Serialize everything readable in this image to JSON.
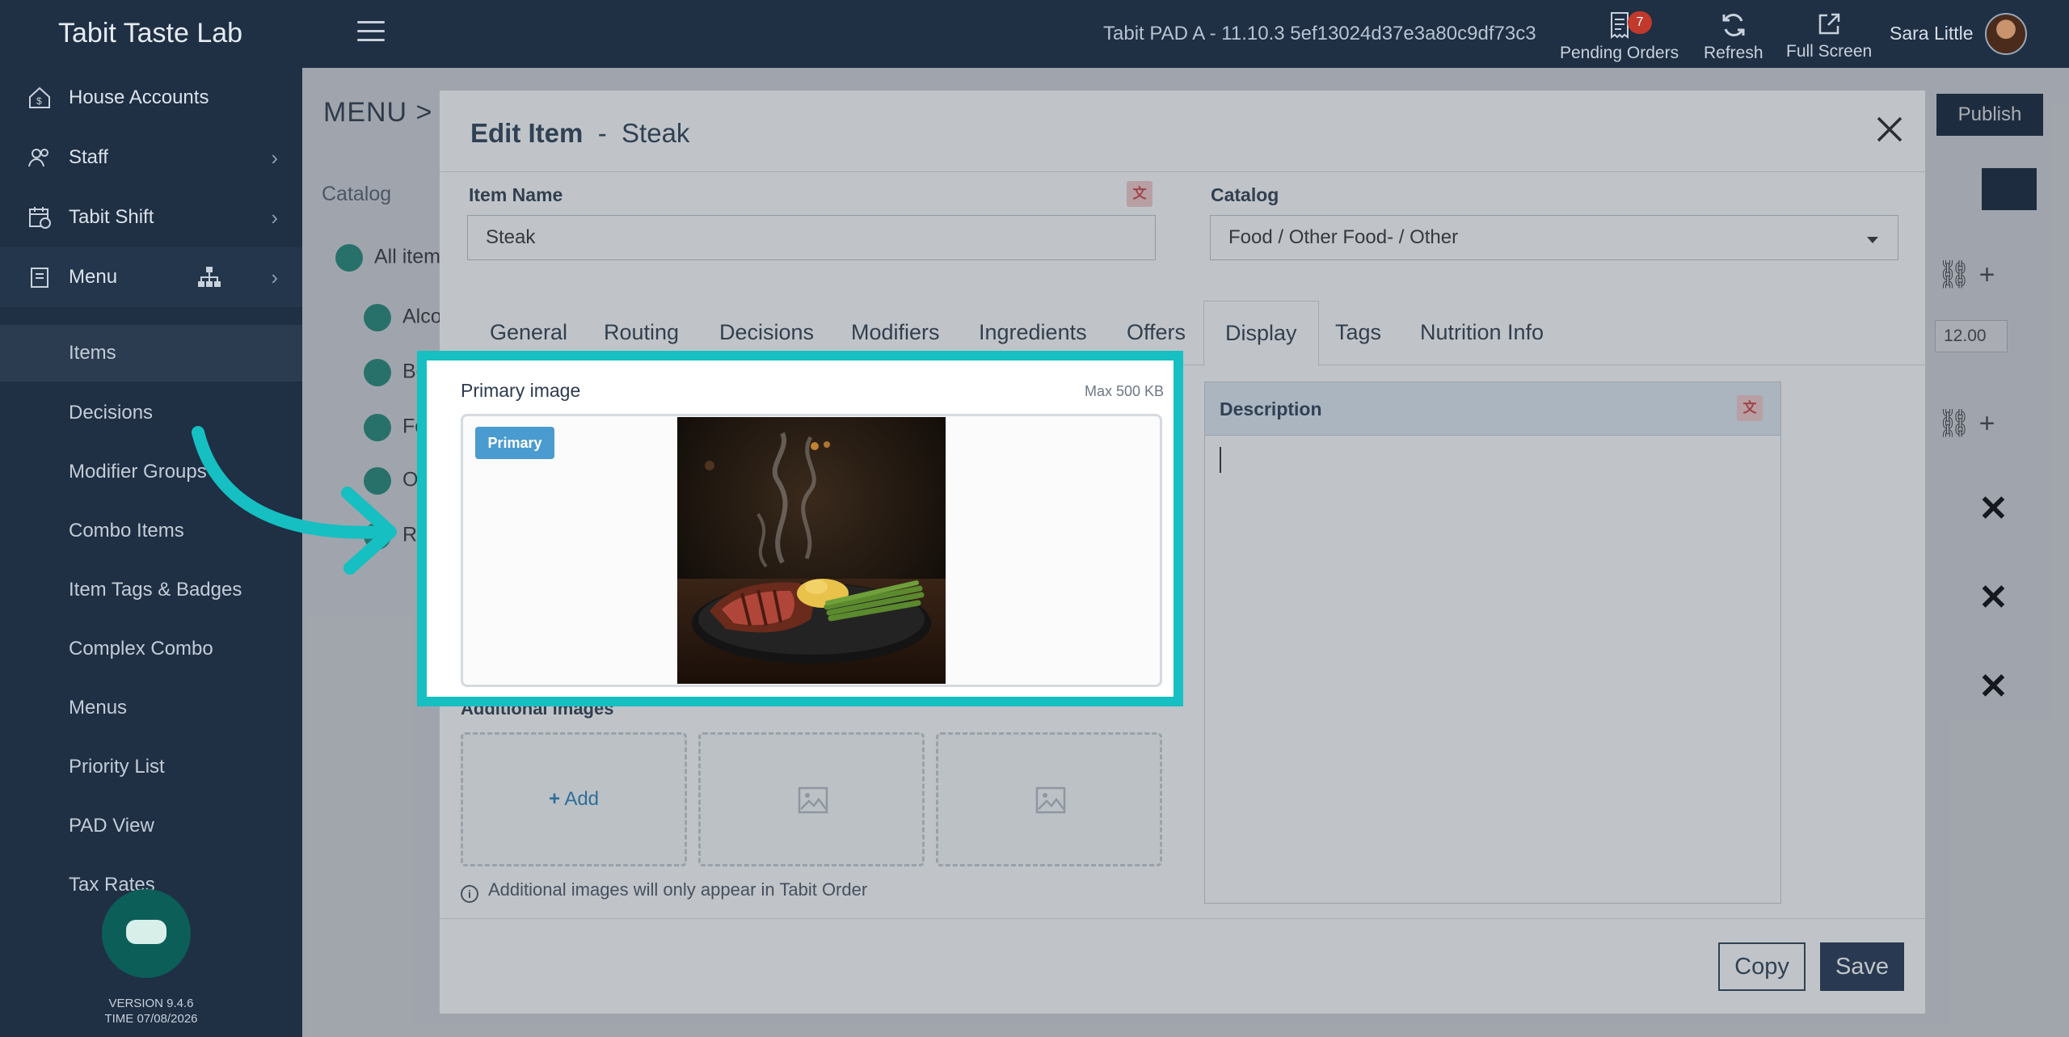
{
  "topbar": {
    "brand": "Tabit Taste Lab",
    "device": "Tabit PAD A - 11.10.3   5ef13024d37e3a80c9df73c3",
    "actions": {
      "pending_orders": "Pending Orders",
      "pending_count": "7",
      "refresh": "Refresh",
      "full_screen": "Full Screen"
    },
    "user_name": "Sara Little"
  },
  "sidebar": {
    "items": [
      {
        "label": "House Accounts",
        "icon": "house-dollar-icon"
      },
      {
        "label": "Staff",
        "icon": "users-icon"
      },
      {
        "label": "Tabit Shift",
        "icon": "calendar-clock-icon"
      },
      {
        "label": "Menu",
        "icon": "menu-book-icon"
      }
    ],
    "sub_items": [
      "Items",
      "Decisions",
      "Modifier Groups",
      "Combo Items",
      "Item Tags & Badges",
      "Complex Combo",
      "Menus",
      "Priority List",
      "PAD View",
      "Tax Rates"
    ],
    "version": "VERSION 9.4.6",
    "time": "TIME 07/08/2026"
  },
  "background": {
    "title": "MENU >",
    "catalog_label": "Catalog",
    "tree": [
      "All item",
      "Alco",
      "Bev",
      "Fo",
      "O h",
      "R ta"
    ],
    "publish": "Publish",
    "price": "12.00"
  },
  "modal": {
    "title_prefix": "Edit Item",
    "title_sep": "-",
    "title_item": "Steak",
    "item_name_label": "Item Name",
    "item_name_value": "Steak",
    "catalog_label": "Catalog",
    "catalog_value": "Food / Other Food- / Other",
    "tabs": [
      "General",
      "Routing",
      "Decisions",
      "Modifiers",
      "Ingredients",
      "Offers",
      "Display",
      "Tags",
      "Nutrition Info"
    ],
    "active_tab": "Display",
    "primary_image_label": "Primary image",
    "max_size": "Max 500 KB",
    "primary_badge": "Primary",
    "additional_images_label": "Additional images",
    "add_label": "Add",
    "info_note": "Additional images will only appear in Tabit Order",
    "description_label": "Description",
    "copy": "Copy",
    "save": "Save"
  },
  "colors": {
    "navy": "#1f2f44",
    "highlight": "#16bfc1",
    "primary_badge": "#4a9bcf",
    "save_button": "#1f3350",
    "badge_red": "#c0392b"
  }
}
